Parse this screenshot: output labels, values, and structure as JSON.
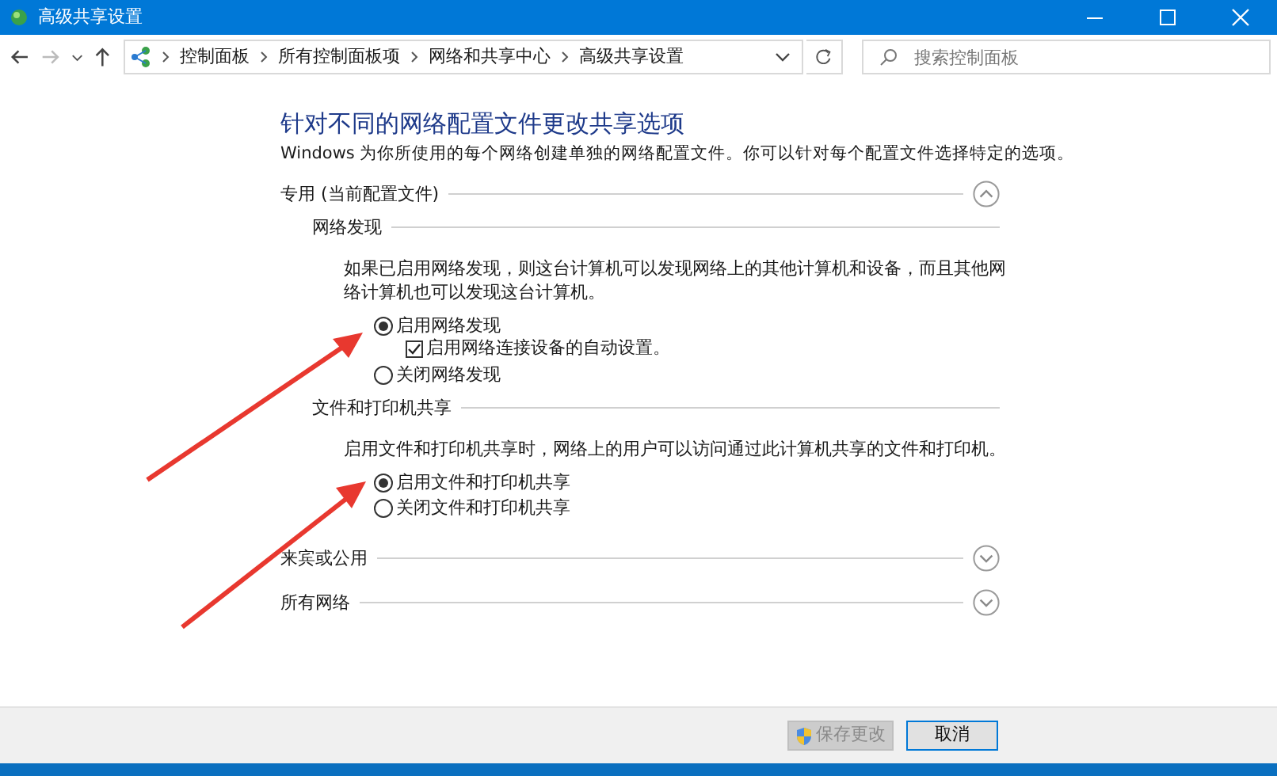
{
  "window": {
    "title": "高级共享设置"
  },
  "address": {
    "crumbs": [
      "控制面板",
      "所有控制面板项",
      "网络和共享中心",
      "高级共享设置"
    ]
  },
  "search": {
    "placeholder": "搜索控制面板"
  },
  "heading": "针对不同的网络配置文件更改共享选项",
  "intro": "Windows 为你所使用的每个网络创建单独的网络配置文件。你可以针对每个配置文件选择特定的选项。",
  "sections": [
    {
      "title": "专用 (当前配置文件)",
      "expanded": true,
      "groups": [
        {
          "title": "网络发现",
          "description": "如果已启用网络发现，则这台计算机可以发现网络上的其他计算机和设备，而且其他网络计算机也可以发现这台计算机。",
          "options": [
            {
              "label": "启用网络发现",
              "selected": true,
              "checkbox": {
                "label": "启用网络连接设备的自动设置。",
                "checked": true
              }
            },
            {
              "label": "关闭网络发现",
              "selected": false
            }
          ]
        },
        {
          "title": "文件和打印机共享",
          "description": "启用文件和打印机共享时，网络上的用户可以访问通过此计算机共享的文件和打印机。",
          "options": [
            {
              "label": "启用文件和打印机共享",
              "selected": true
            },
            {
              "label": "关闭文件和打印机共享",
              "selected": false
            }
          ]
        }
      ]
    },
    {
      "title": "来宾或公用",
      "expanded": false
    },
    {
      "title": "所有网络",
      "expanded": false
    }
  ],
  "buttons": [
    {
      "label": "保存更改",
      "disabled": true,
      "shield": true
    },
    {
      "label": "取消",
      "disabled": false,
      "shield": false
    }
  ]
}
